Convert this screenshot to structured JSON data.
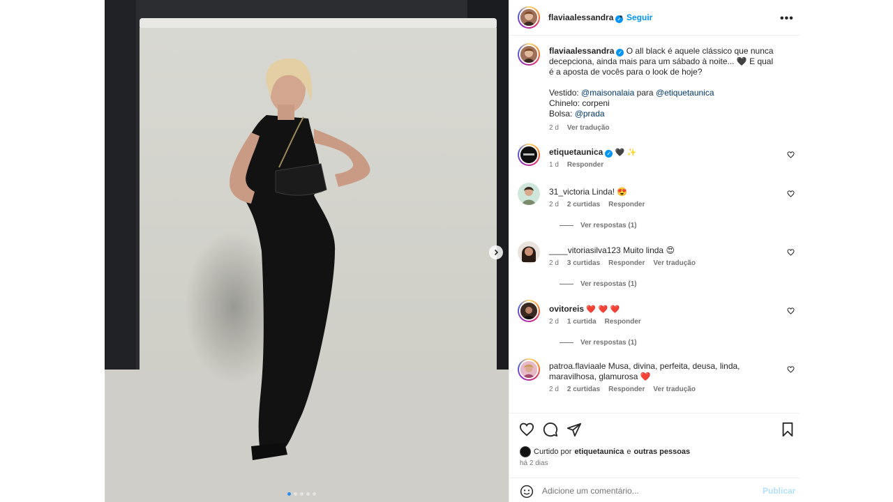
{
  "post": {
    "author": "flaviaalessandra",
    "follow_label": "Seguir",
    "more_label": "•••",
    "separator": "•"
  },
  "caption": {
    "username": "flaviaalessandra",
    "text": "O all black é aquele clássico que nunca decepciona, ainda mais para um sábado à noite... 🖤 E qual é a aposta de vocês para o look de hoje?",
    "dress_label": "Vestido: ",
    "dress_mention": "@maisonalaia",
    "para": " para ",
    "para_mention": "@etiquetaunica",
    "slipper_line": "Chinelo: corpeni",
    "bag_label": "Bolsa: ",
    "bag_mention": "@prada",
    "time": "2 d",
    "translate": "Ver tradução"
  },
  "comments": [
    {
      "username": "etiquetaunica",
      "verified": true,
      "text": "🖤 ✨",
      "time": "1 d",
      "likes": "",
      "reply": "Responder",
      "translate": "",
      "view_replies": ""
    },
    {
      "username": "31_victoria",
      "verified": false,
      "text": "Linda! 😍",
      "time": "2 d",
      "likes": "2 curtidas",
      "reply": "Responder",
      "translate": "",
      "view_replies": "Ver respostas (1)"
    },
    {
      "username": "____vitoriasilva123",
      "verified": false,
      "text": "Muito linda 😍",
      "time": "2 d",
      "likes": "3 curtidas",
      "reply": "Responder",
      "translate": "Ver tradução",
      "view_replies": "Ver respostas (1)"
    },
    {
      "username": "ovitoreis",
      "verified": false,
      "text": "❤️ ❤️ ❤️",
      "time": "2 d",
      "likes": "1 curtida",
      "reply": "Responder",
      "translate": "",
      "view_replies": "Ver respostas (1)"
    },
    {
      "username": "patroa.flaviaale",
      "verified": false,
      "text": "Musa, divina, perfeita, deusa, linda, maravilhosa, glamurosa ❤️",
      "time": "2 d",
      "likes": "2 curtidas",
      "reply": "Responder",
      "translate": "Ver tradução",
      "view_replies": ""
    }
  ],
  "liked_by": {
    "prefix": "Curtido por",
    "user": "etiquetaunica",
    "conj": "e",
    "others": "outras pessoas"
  },
  "posted_ago": "há 2 dias",
  "add_comment": {
    "placeholder": "Adicione um comentário...",
    "post_label": "Publicar"
  },
  "carousel": {
    "count": 5,
    "active_index": 0
  },
  "colors": {
    "accent": "#0095f6",
    "link": "#00376b",
    "muted": "#737373"
  },
  "icons": [
    "chevron-right-icon",
    "heart-icon",
    "comment-icon",
    "share-icon",
    "bookmark-icon",
    "emoji-icon",
    "verified-icon",
    "more-icon"
  ]
}
